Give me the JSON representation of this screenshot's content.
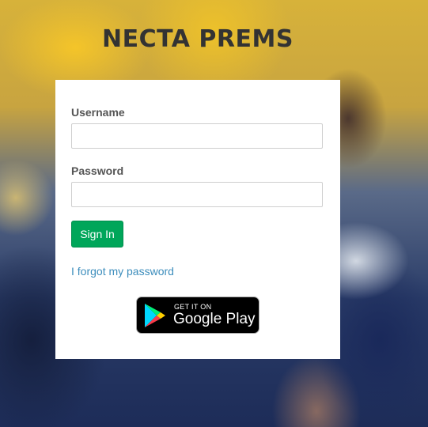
{
  "header": {
    "title": "NECTA PREMS"
  },
  "login": {
    "username_label": "Username",
    "username_value": "",
    "password_label": "Password",
    "password_value": "",
    "sign_in_label": "Sign In",
    "forgot_link": "I forgot my password"
  },
  "badge": {
    "top_text": "GET IT ON",
    "main_text": "Google Play"
  },
  "colors": {
    "primary_button": "#00a65a",
    "link": "#3c8dbc",
    "title": "#333333"
  }
}
